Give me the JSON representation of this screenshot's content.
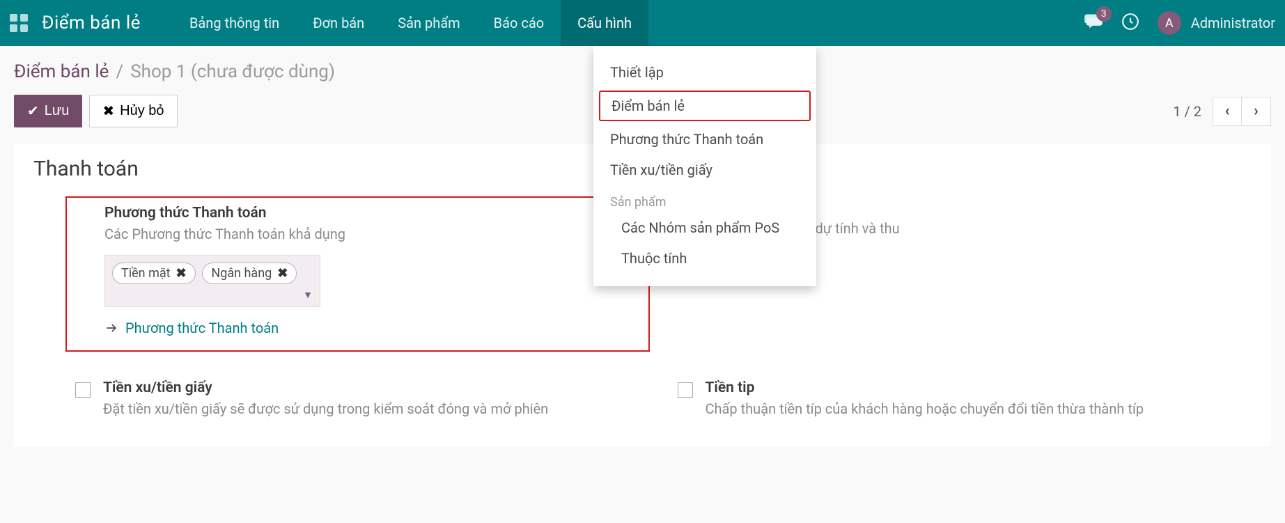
{
  "topbar": {
    "brand": "Điểm bán lẻ",
    "nav": [
      "Bảng thông tin",
      "Đơn bán",
      "Sản phẩm",
      "Báo cáo",
      "Cấu hình"
    ],
    "badge": "3",
    "avatar_letter": "A",
    "username": "Administrator"
  },
  "dropdown": {
    "items_top": [
      "Thiết lập",
      "Điểm bán lẻ",
      "Phương thức Thanh toán",
      "Tiền xu/tiền giấy"
    ],
    "section": "Sản phẩm",
    "items_sub": [
      "Các Nhóm sản phẩm PoS",
      "Thuộc tính"
    ]
  },
  "breadcrumb": {
    "root": "Điểm bán lẻ",
    "sep": "/",
    "current": "Shop 1 (chưa được dùng)"
  },
  "actions": {
    "save": "Lưu",
    "cancel": "Hủy bỏ",
    "pager": "1 / 2"
  },
  "section": {
    "title": "Thanh toán",
    "payment": {
      "title": "Phương thức Thanh toán",
      "desc": "Các Phương thức Thanh toán khả dụng",
      "tags": [
        "Tiền mặt",
        "Ngân hàng"
      ],
      "link": "Phương thức Thanh toán"
    },
    "right_top_fragment": "phép giữa số tiền dự tính và thu",
    "coins": {
      "title": "Tiền xu/tiền giấy",
      "desc": "Đặt tiền xu/tiền giấy sẽ được sử dụng trong kiểm soát đóng và mở phiên"
    },
    "tip": {
      "title": "Tiền tip",
      "desc": "Chấp thuận tiền típ của khách hàng hoặc chuyển đổi tiền thừa thành típ"
    }
  }
}
